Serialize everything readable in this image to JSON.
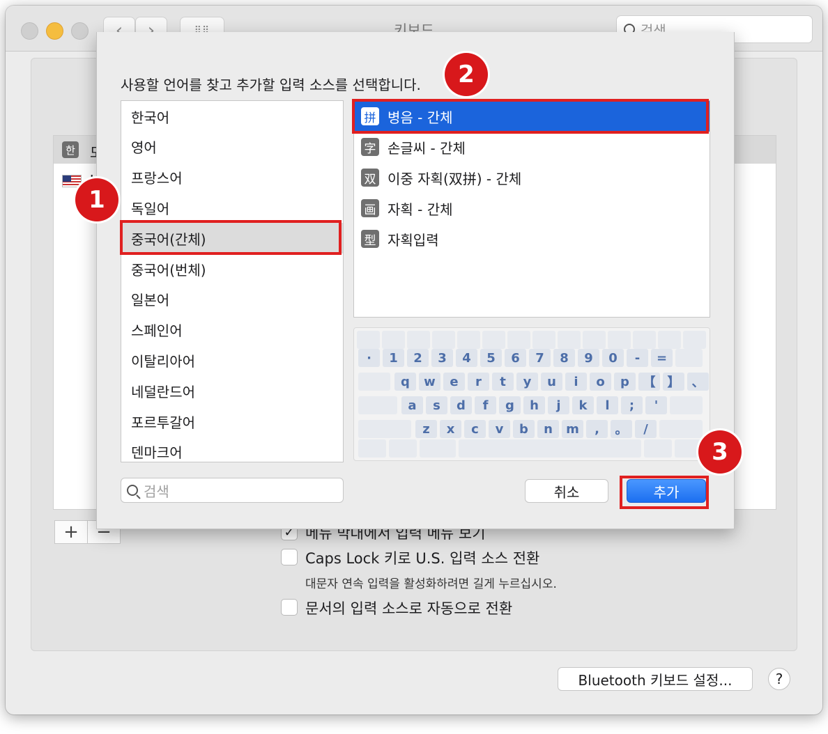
{
  "window": {
    "title": "키보드",
    "search_placeholder": "검색"
  },
  "background": {
    "list_items": [
      {
        "icon": "한",
        "label": "모"
      },
      {
        "icon": "us-flag",
        "label": "U"
      }
    ],
    "add_label": "+",
    "remove_label": "−",
    "checkboxes": [
      {
        "label": "메뉴 막대에서 입력 메뉴 보기",
        "checked": true
      },
      {
        "label": "Caps Lock 키로 U.S. 입력 소스 전환",
        "checked": false
      },
      {
        "label": "문서의 입력 소스로 자동으로 전환",
        "checked": false
      }
    ],
    "caps_note": "대문자 연속 입력을 활성화하려면 길게 누르십시오.",
    "bluetooth_button": "Bluetooth 키보드 설정...",
    "help_label": "?"
  },
  "sheet": {
    "prompt": "사용할 언어를 찾고 추가할 입력 소스를 선택합니다.",
    "languages": [
      "한국어",
      "영어",
      "프랑스어",
      "독일어",
      "중국어(간체)",
      "중국어(번체)",
      "일본어",
      "스페인어",
      "이탈리아어",
      "네덜란드어",
      "포르투갈어",
      "덴마크어"
    ],
    "selected_language": "중국어(간체)",
    "input_sources": [
      {
        "icon": "拼",
        "label": "병음 - 간체",
        "selected": true
      },
      {
        "icon": "字",
        "label": "손글씨 - 간체",
        "selected": false
      },
      {
        "icon": "双",
        "label": "이중 자획(双拼) - 간체",
        "selected": false
      },
      {
        "icon": "画",
        "label": "자획 - 간체",
        "selected": false
      },
      {
        "icon": "型",
        "label": "자획입력",
        "selected": false
      }
    ],
    "keyboard_rows": [
      [
        "·",
        "1",
        "2",
        "3",
        "4",
        "5",
        "6",
        "7",
        "8",
        "9",
        "0",
        "-",
        "="
      ],
      [
        "q",
        "w",
        "e",
        "r",
        "t",
        "y",
        "u",
        "i",
        "o",
        "p",
        "【",
        "】",
        "、"
      ],
      [
        "a",
        "s",
        "d",
        "f",
        "g",
        "h",
        "j",
        "k",
        "l",
        ";",
        "'"
      ],
      [
        "z",
        "x",
        "c",
        "v",
        "b",
        "n",
        "m",
        ",",
        "。",
        "/"
      ]
    ],
    "search_placeholder": "검색",
    "cancel_label": "취소",
    "add_label": "추가"
  },
  "annotations": {
    "step1": "1",
    "step2": "2",
    "step3": "3",
    "highlight_color": "#e02020"
  },
  "colors": {
    "selection_blue": "#1b64dc",
    "step_red": "#d8181b"
  }
}
